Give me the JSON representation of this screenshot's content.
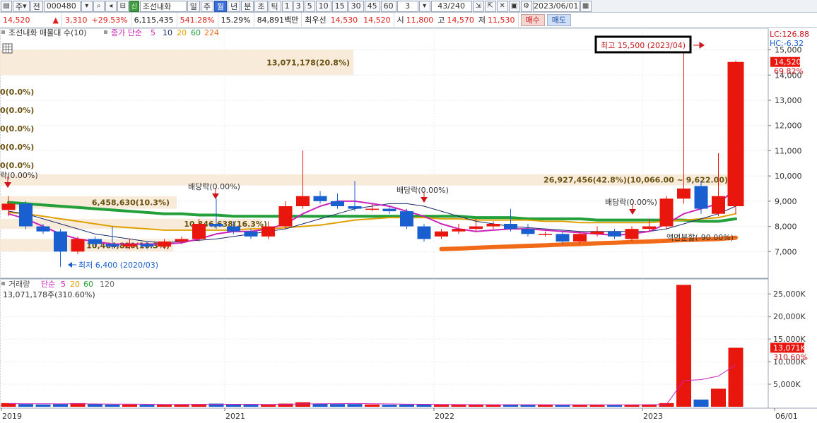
{
  "toolbar": {
    "code_prefix": "주",
    "period_label": "전",
    "stock_code": "000480",
    "stock_name": "조선내화",
    "stock_badge": "신",
    "periods": [
      "일",
      "주",
      "월",
      "년",
      "분",
      "초",
      "틱"
    ],
    "active_period": "월",
    "intervals": [
      "1",
      "3",
      "5",
      "10",
      "15",
      "30",
      "45",
      "60"
    ],
    "interval_value": "3",
    "count": "43/240",
    "date": "2023/06/01"
  },
  "quote": {
    "price": "14,520",
    "change_arrow": "▲",
    "change": "3,310",
    "change_pct": "+29.53%",
    "volume": "6,115,435",
    "volume_ratio": "541.28%",
    "turnover": "15.29%",
    "amount": "84,891백만",
    "best_label": "최우선",
    "ask": "14,530",
    "bid": "14,520",
    "open_label": "시",
    "open": "11,800",
    "high_label": "고",
    "high": "14,570",
    "low_label": "저",
    "low": "11,530",
    "buy_label": "매수",
    "sell_label": "매도"
  },
  "legend": {
    "profile_title": "조선내화 매물대 수(10)",
    "ma_title": "종가 단순",
    "ma_periods": [
      "5",
      "10",
      "20",
      "60",
      "224"
    ],
    "volume_title": "거래량",
    "volume_ma_title": "단순",
    "volume_ma_periods": [
      "5",
      "20",
      "60",
      "120"
    ],
    "volume_value": "13,071,178주(310.60%)"
  },
  "colors": {
    "up": "#e8160c",
    "down": "#1a5fd0",
    "ma5": "#cc22bb",
    "ma10": "#1a2a6a",
    "ma20": "#e0a000",
    "ma60": "#24a03a",
    "ma224": "#f06a18",
    "profile": "#f7e8d4"
  },
  "annotations": {
    "lc": "LC:126.88",
    "hc": "HC:-6.32",
    "high_marker": "최고 15,500 (2023/04)",
    "low_marker": "최저 6,400 (2020/03)",
    "profile_top": "13,071,178(20.8%)",
    "profile_mid": "26,927,456(42.8%)(10,066.00 ~ 9,622.00)",
    "profile_b1": "6,458,630(10.3%)",
    "profile_b2": "10,846,638(16.3%)",
    "profile_b3": "10,464,820(10.3%)",
    "zero_1": "0(0.0%)",
    "zero_2": "0(0.0%)",
    "zero_3": "0(0.0%)",
    "zero_4": "0(0.0%)",
    "zero_5": "0(0.0%)",
    "dividend_left": "락(0.00%)",
    "dividend_1": "배당락(0.00%)",
    "dividend_2": "배당락(0.00%)",
    "dividend_3": "배당락(0.00%)",
    "split": "액면분할(-90.00%)",
    "price_tag": "14,520",
    "price_tag_pct": "69.82%",
    "vol_tag": "13,071K",
    "vol_tag_pct": "310.60%"
  },
  "chart_data": [
    {
      "type": "candlestick",
      "title": "",
      "ylim": [
        6000,
        15800
      ],
      "y_ticks": [
        "15,000",
        "14,000",
        "13,000",
        "12,000",
        "11,000",
        "10,000",
        "9,000",
        "8,000",
        "7,000"
      ],
      "x_ticks": [
        "2019",
        "2021",
        "2022",
        "2023",
        "06/01"
      ],
      "candles": [
        {
          "o": 8650,
          "c": 8900,
          "h": 9200,
          "l": 8400
        },
        {
          "o": 8900,
          "c": 8000,
          "h": 9000,
          "l": 7900
        },
        {
          "o": 8000,
          "c": 7800,
          "h": 8100,
          "l": 7700
        },
        {
          "o": 7800,
          "c": 7000,
          "h": 7900,
          "l": 6400
        },
        {
          "o": 7000,
          "c": 7500,
          "h": 7600,
          "l": 6900
        },
        {
          "o": 7500,
          "c": 7300,
          "h": 7600,
          "l": 7200
        },
        {
          "o": 7300,
          "c": 7200,
          "h": 8000,
          "l": 7100
        },
        {
          "o": 7200,
          "c": 7300,
          "h": 7500,
          "l": 7100
        },
        {
          "o": 7300,
          "c": 7200,
          "h": 7400,
          "l": 7100
        },
        {
          "o": 7200,
          "c": 7400,
          "h": 7500,
          "l": 7100
        },
        {
          "o": 7400,
          "c": 7500,
          "h": 7600,
          "l": 7300
        },
        {
          "o": 7500,
          "c": 8100,
          "h": 8300,
          "l": 7400
        },
        {
          "o": 8100,
          "c": 8000,
          "h": 9100,
          "l": 7900
        },
        {
          "o": 8000,
          "c": 7800,
          "h": 8200,
          "l": 7700
        },
        {
          "o": 7800,
          "c": 7600,
          "h": 7900,
          "l": 7500
        },
        {
          "o": 7600,
          "c": 8000,
          "h": 8200,
          "l": 7500
        },
        {
          "o": 8000,
          "c": 8800,
          "h": 9000,
          "l": 7900
        },
        {
          "o": 8800,
          "c": 9200,
          "h": 11000,
          "l": 8700
        },
        {
          "o": 9200,
          "c": 9000,
          "h": 9400,
          "l": 8900
        },
        {
          "o": 9000,
          "c": 8800,
          "h": 9300,
          "l": 8700
        },
        {
          "o": 8800,
          "c": 8700,
          "h": 9800,
          "l": 8600
        },
        {
          "o": 8700,
          "c": 8700,
          "h": 8900,
          "l": 8600
        },
        {
          "o": 8700,
          "c": 8600,
          "h": 8800,
          "l": 8500
        },
        {
          "o": 8600,
          "c": 8000,
          "h": 8700,
          "l": 7900
        },
        {
          "o": 8000,
          "c": 7500,
          "h": 8100,
          "l": 7400
        },
        {
          "o": 7600,
          "c": 7800,
          "h": 7900,
          "l": 7500
        },
        {
          "o": 7800,
          "c": 7900,
          "h": 8100,
          "l": 7700
        },
        {
          "o": 7900,
          "c": 8000,
          "h": 8300,
          "l": 7800
        },
        {
          "o": 8000,
          "c": 8100,
          "h": 8200,
          "l": 7900
        },
        {
          "o": 8100,
          "c": 7900,
          "h": 8700,
          "l": 7800
        },
        {
          "o": 7900,
          "c": 7700,
          "h": 8100,
          "l": 7600
        },
        {
          "o": 7700,
          "c": 7700,
          "h": 7800,
          "l": 7600
        },
        {
          "o": 7700,
          "c": 7400,
          "h": 7800,
          "l": 7300
        },
        {
          "o": 7400,
          "c": 7700,
          "h": 7800,
          "l": 7300
        },
        {
          "o": 7700,
          "c": 7800,
          "h": 8000,
          "l": 7600
        },
        {
          "o": 7800,
          "c": 7600,
          "h": 7900,
          "l": 7500
        },
        {
          "o": 7500,
          "c": 7900,
          "h": 8000,
          "l": 7400
        },
        {
          "o": 7900,
          "c": 8000,
          "h": 8300,
          "l": 7800
        },
        {
          "o": 8000,
          "c": 9100,
          "h": 9200,
          "l": 7900
        },
        {
          "o": 9100,
          "c": 9500,
          "h": 15500,
          "l": 8900
        },
        {
          "o": 9600,
          "c": 8700,
          "h": 9800,
          "l": 8500
        },
        {
          "o": 8500,
          "c": 9200,
          "h": 10900,
          "l": 8400
        },
        {
          "o": 8800,
          "c": 14520,
          "h": 14570,
          "l": 8500
        }
      ],
      "ma": {
        "5": [
          8500,
          8300,
          8000,
          7700,
          7500,
          7400,
          7300,
          7300,
          7300,
          7300,
          7350,
          7500,
          7700,
          7800,
          7800,
          7900,
          8100,
          8500,
          8800,
          9000,
          9000,
          8900,
          8800,
          8600,
          8400,
          8100,
          7900,
          7800,
          7850,
          7900,
          7900,
          7850,
          7800,
          7750,
          7700,
          7650,
          7700,
          7800,
          8100,
          8500,
          8700,
          8900,
          9500
        ],
        "10": [
          8600,
          8500,
          8300,
          8100,
          7900,
          7700,
          7600,
          7500,
          7400,
          7350,
          7400,
          7450,
          7500,
          7600,
          7700,
          7800,
          7900,
          8100,
          8300,
          8500,
          8700,
          8800,
          8900,
          8900,
          8800,
          8600,
          8400,
          8200,
          8100,
          8000,
          7950,
          7900,
          7850,
          7800,
          7800,
          7800,
          7800,
          7800,
          7900,
          8100,
          8300,
          8500,
          8800
        ],
        "20": [
          8550,
          8500,
          8400,
          8300,
          8200,
          8100,
          8000,
          7950,
          7900,
          7850,
          7850,
          7850,
          7850,
          7850,
          7900,
          7900,
          7950,
          8000,
          8050,
          8150,
          8250,
          8300,
          8350,
          8350,
          8350,
          8300,
          8300,
          8250,
          8250,
          8250,
          8250,
          8200,
          8200,
          8150,
          8150,
          8150,
          8150,
          8150,
          8200,
          8250,
          8300,
          8350,
          8500
        ],
        "60": [
          8950,
          8900,
          8850,
          8800,
          8750,
          8700,
          8650,
          8600,
          8550,
          8500,
          8500,
          8450,
          8450,
          8400,
          8400,
          8400,
          8400,
          8400,
          8400,
          8400,
          8400,
          8400,
          8400,
          8400,
          8400,
          8400,
          8400,
          8350,
          8350,
          8350,
          8300,
          8300,
          8300,
          8300,
          8250,
          8250,
          8250,
          8250,
          8250,
          8250,
          8200,
          8200,
          8300
        ],
        "224": [
          null,
          null,
          null,
          null,
          null,
          null,
          null,
          null,
          null,
          null,
          null,
          null,
          null,
          null,
          null,
          null,
          null,
          null,
          null,
          null,
          null,
          null,
          null,
          null,
          null,
          7100,
          7120,
          7150,
          7180,
          7200,
          7230,
          7250,
          7280,
          7300,
          7330,
          7350,
          7380,
          7400,
          7430,
          7460,
          7480,
          7500,
          7550
        ]
      },
      "profile_bands": [
        {
          "low": 14000,
          "high": 15000,
          "label": "13,071,178(20.8%)"
        },
        {
          "low": 9622,
          "high": 10066,
          "label": "26,927,456(42.8%)(10,066.00 ~ 9,622.00)"
        },
        {
          "low": 8700,
          "high": 9200,
          "label": "6,458,630(10.3%)"
        },
        {
          "low": 7900,
          "high": 8300,
          "label": "10,846,638(16.3%)"
        },
        {
          "low": 7000,
          "high": 7500,
          "label": "10,464,820(10.3%)"
        }
      ]
    },
    {
      "type": "bar",
      "title": "",
      "ylim": [
        0,
        28000
      ],
      "y_ticks": [
        "25,000K",
        "20,000K",
        "15,000K",
        "10,000K",
        "5,000K"
      ],
      "volume_k": [
        800,
        600,
        500,
        600,
        800,
        600,
        500,
        500,
        450,
        450,
        500,
        600,
        700,
        500,
        450,
        450,
        700,
        1000,
        700,
        600,
        600,
        500,
        450,
        500,
        500,
        450,
        450,
        450,
        450,
        500,
        450,
        400,
        450,
        400,
        450,
        450,
        450,
        500,
        800,
        27000,
        1600,
        4000,
        13071
      ],
      "vol_ma5_k": [
        700,
        680,
        660,
        640,
        650,
        620,
        600,
        580,
        550,
        520,
        500,
        510,
        530,
        550,
        540,
        520,
        540,
        620,
        660,
        690,
        720,
        680,
        620,
        570,
        550,
        510,
        480,
        470,
        460,
        460,
        460,
        450,
        440,
        430,
        430,
        430,
        440,
        450,
        520,
        5800,
        6000,
        6800,
        9300
      ]
    }
  ]
}
